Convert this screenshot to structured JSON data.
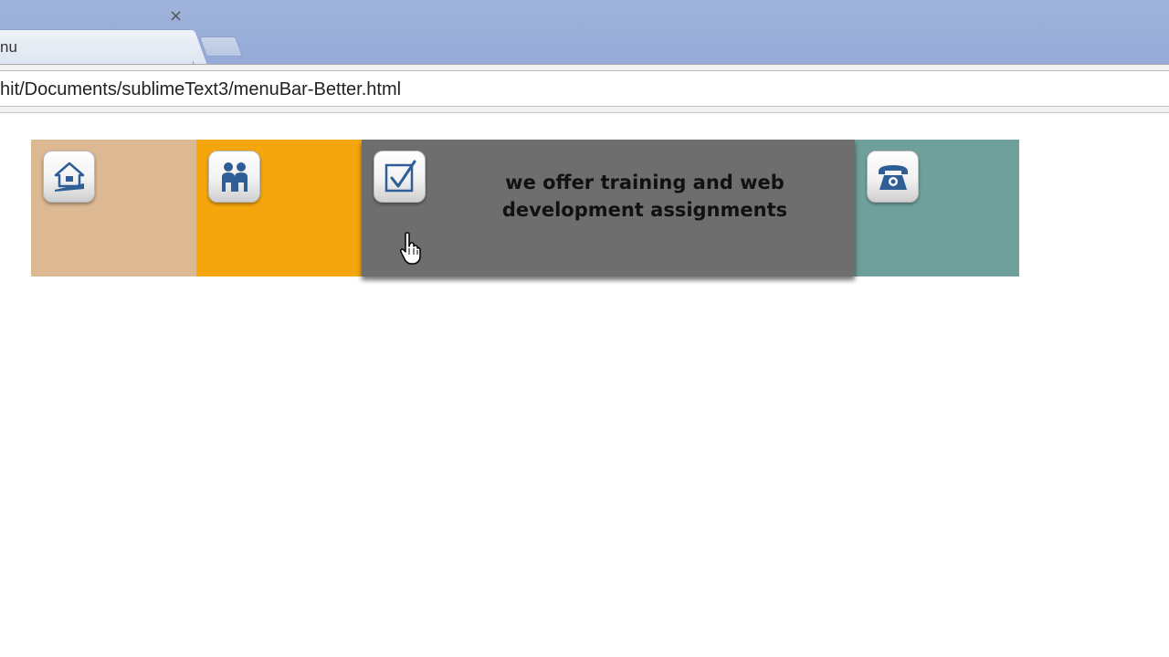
{
  "browser": {
    "tab_title": "nu",
    "tab_close": "×",
    "address_url": "hit/Documents/sublimeText3/menuBar-Better.html"
  },
  "menu": {
    "items": [
      {
        "id": "home",
        "icon": "house-icon",
        "color": "#dcb893"
      },
      {
        "id": "about",
        "icon": "people-icon",
        "color": "#f5a60d"
      },
      {
        "id": "services",
        "icon": "checkbox-icon",
        "color": "#6e6e6e",
        "hover_text": "we offer training and web development assignments"
      },
      {
        "id": "contact",
        "icon": "telephone-icon",
        "color": "#70a09c"
      }
    ]
  },
  "colors": {
    "icon_blue": "#2f5e96",
    "chrome_blue": "#9fb3da"
  }
}
